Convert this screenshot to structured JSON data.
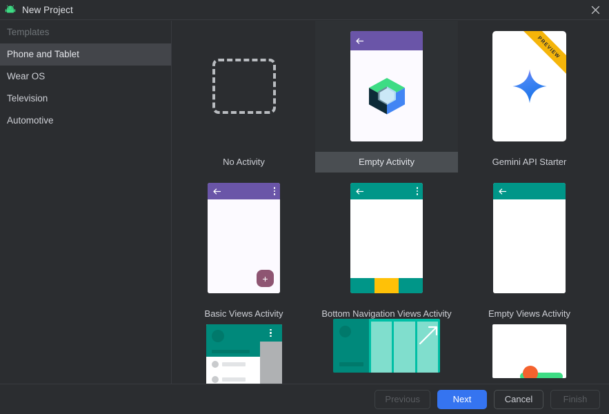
{
  "window": {
    "title": "New Project",
    "app_icon": "android-robot-icon",
    "close_icon": "close-icon"
  },
  "sidebar": {
    "header": "Templates",
    "items": [
      {
        "label": "Phone and Tablet",
        "selected": true
      },
      {
        "label": "Wear OS",
        "selected": false
      },
      {
        "label": "Television",
        "selected": false
      },
      {
        "label": "Automotive",
        "selected": false
      }
    ]
  },
  "templates": {
    "selected": "Empty Activity",
    "rows": [
      [
        {
          "label": "No Activity",
          "preview": "dashed-placeholder",
          "selected": false,
          "badge": ""
        },
        {
          "label": "Empty Activity",
          "preview": "compose-cube",
          "selected": true,
          "badge": ""
        },
        {
          "label": "Gemini API Starter",
          "preview": "gemini-spark",
          "selected": false,
          "badge": "PREVIEW"
        }
      ],
      [
        {
          "label": "Basic Views Activity",
          "preview": "purple-appbar-fab",
          "selected": false,
          "badge": ""
        },
        {
          "label": "Bottom Navigation Views Activity",
          "preview": "teal-appbar-bottomnav",
          "selected": false,
          "badge": ""
        },
        {
          "label": "Empty Views Activity",
          "preview": "teal-appbar-empty",
          "selected": false,
          "badge": ""
        }
      ],
      [
        {
          "label": "",
          "preview": "navigation-drawer",
          "selected": false,
          "badge": ""
        },
        {
          "label": "",
          "preview": "landscape-panels",
          "selected": false,
          "badge": ""
        },
        {
          "label": "",
          "preview": "white-android-mascot",
          "selected": false,
          "badge": ""
        }
      ]
    ]
  },
  "footer": {
    "buttons": [
      {
        "label": "Previous",
        "state": "disabled"
      },
      {
        "label": "Next",
        "state": "primary"
      },
      {
        "label": "Cancel",
        "state": "normal"
      },
      {
        "label": "Finish",
        "state": "disabled"
      }
    ]
  },
  "colors": {
    "window_bg": "#2B2D30",
    "selected_row": "#43454A",
    "selected_tile_label": "#4A4E52",
    "primary_button": "#3574F0",
    "appbar_purple": "#6A55A8",
    "appbar_teal": "#009688",
    "fab": "#8E5572",
    "ribbon": "#F5B50A",
    "bottomnav_accent": "#FFC107",
    "compose_green": "#3DDC84",
    "compose_blue": "#4285F4",
    "mascot_orange": "#F4622E"
  }
}
